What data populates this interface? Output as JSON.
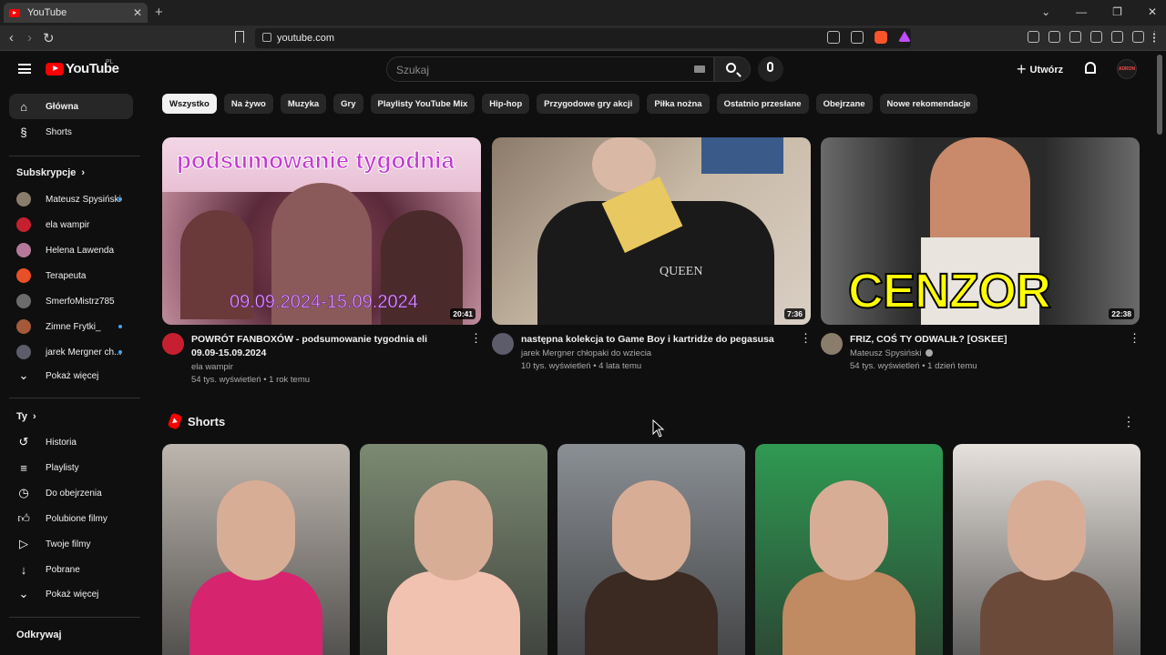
{
  "browser": {
    "tab_title": "YouTube",
    "url": "youtube.com",
    "new_tab_symbol": "+",
    "tab_close_symbol": "✕"
  },
  "header": {
    "logo_text": "YouTube",
    "country_code": "PL",
    "search_placeholder": "Szukaj",
    "create_label": "Utwórz",
    "avatar_text": "ADRON"
  },
  "sidebar": {
    "main": [
      {
        "label": "Główna",
        "icon": "home-icon"
      },
      {
        "label": "Shorts",
        "icon": "shorts-icon"
      }
    ],
    "subscriptions_heading": "Subskrypcje",
    "subscriptions": [
      {
        "label": "Mateusz Spysiński",
        "color": "#8a7d6b",
        "new": true
      },
      {
        "label": "ela wampir",
        "color": "#c62030",
        "new": false
      },
      {
        "label": "Helena Lawenda",
        "color": "#b57a9a",
        "new": false
      },
      {
        "label": "Terapeuta",
        "color": "#e8502a",
        "new": false
      },
      {
        "label": "SmerfoMistrz785",
        "color": "#6b6b6b",
        "new": false
      },
      {
        "label": "Zimne Frytki_",
        "color": "#a45a3a",
        "new": true
      },
      {
        "label": "jarek Mergner ch...",
        "color": "#5c5c6a",
        "new": true
      }
    ],
    "show_more": "Pokaż więcej",
    "you_heading": "Ty",
    "you_items": [
      {
        "label": "Historia",
        "icon": "history-icon"
      },
      {
        "label": "Playlisty",
        "icon": "playlist-icon"
      },
      {
        "label": "Do obejrzenia",
        "icon": "watch-later-icon"
      },
      {
        "label": "Polubione filmy",
        "icon": "thumbs-up-icon"
      },
      {
        "label": "Twoje filmy",
        "icon": "your-videos-icon"
      },
      {
        "label": "Pobrane",
        "icon": "download-icon"
      }
    ],
    "show_more_2": "Pokaż więcej",
    "explore_heading": "Odkrywaj"
  },
  "chips": [
    "Wszystko",
    "Na żywo",
    "Muzyka",
    "Gry",
    "Playlisty YouTube Mix",
    "Hip-hop",
    "Przygodowe gry akcji",
    "Piłka nożna",
    "Ostatnio przesłane",
    "Obejrzane",
    "Nowe rekomendacje"
  ],
  "videos": [
    {
      "title": "POWRÓT FANBOXÓW - podsumowanie tygodnia eli 09.09-15.09.2024",
      "channel": "ela wampir",
      "stats": "54 tys. wyświetleń • 1 rok temu",
      "duration": "20:41",
      "thumb_top_text": "podsumowanie tygodnia",
      "thumb_bottom_text": "09.09.2024-15.09.2024",
      "avatar_color": "#c62030"
    },
    {
      "title": "następna kolekcja to Game Boy i kartridże do pegasusa",
      "channel": "jarek Mergner chłopaki do wziecia",
      "stats": "10 tys. wyświetleń • 4 lata temu",
      "duration": "7:36",
      "thumb_shirt_text": "QUEEN",
      "avatar_color": "#5c5c6a"
    },
    {
      "title": "FRIZ, COŚ TY ODWALIŁ? [OSKEE]",
      "channel": "Mateusz Spysiński",
      "stats": "54 tys. wyświetleń • 1 dzień temu",
      "duration": "22:38",
      "thumb_text": "CENZOR",
      "avatar_color": "#8a7d6b"
    }
  ],
  "shorts": {
    "heading": "Shorts",
    "items": [
      {
        "bg": "#bdb6ae",
        "accent": "#d6246e"
      },
      {
        "bg": "#7b8a72",
        "accent": "#f2c2b0"
      },
      {
        "bg": "#8a8f94",
        "accent": "#3b2a22"
      },
      {
        "bg": "#2f9a52",
        "accent": "#c08a62"
      },
      {
        "bg": "#e6e1dc",
        "accent": "#6b4a3a"
      }
    ]
  },
  "colors": {
    "background": "#0f0f0f",
    "brand_red": "#ff0000",
    "chip_bg": "#272727",
    "active_chip_bg": "#f1f1f1"
  }
}
